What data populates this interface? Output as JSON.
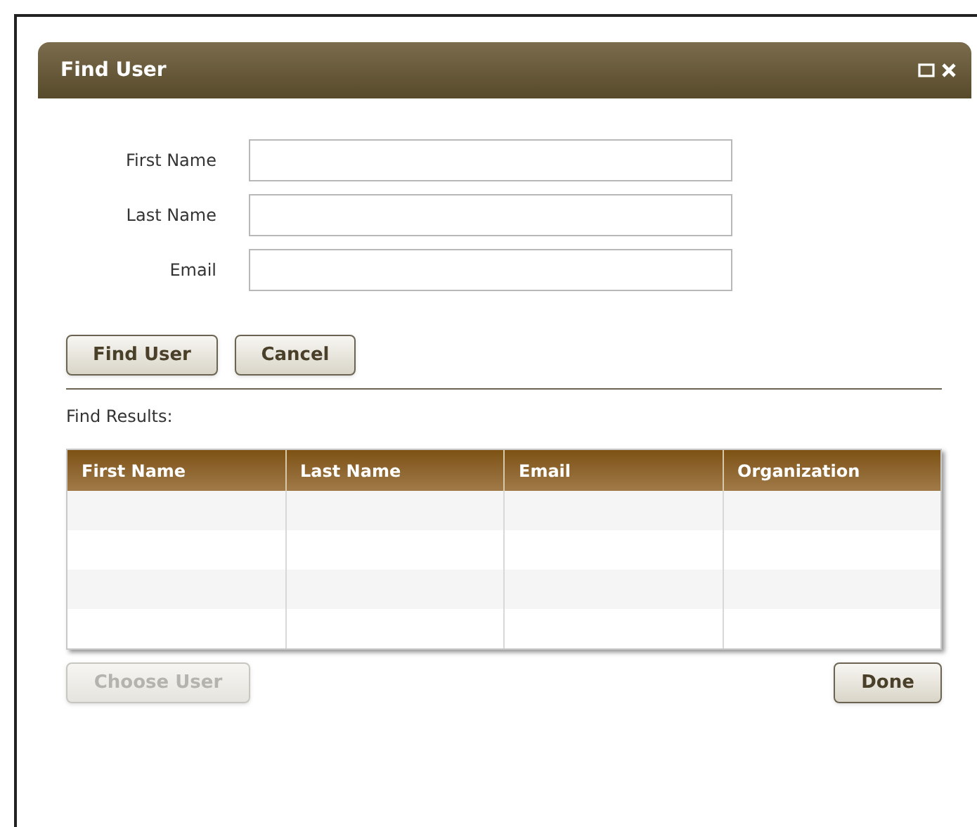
{
  "window": {
    "title": "Find User"
  },
  "fields": [
    {
      "label": "First Name"
    },
    {
      "label": "Last Name"
    },
    {
      "label": "Email"
    }
  ],
  "actions": [
    {
      "label": "Find User",
      "disabled": false
    },
    {
      "label": "Cancel",
      "disabled": false
    }
  ],
  "results": {
    "label": "Find Results:",
    "columns": [
      "First Name",
      "Last Name",
      "Email",
      "Organization"
    ]
  },
  "footer": [
    {
      "label": "Choose User",
      "disabled": true
    },
    {
      "label": "Done",
      "disabled": false
    }
  ]
}
